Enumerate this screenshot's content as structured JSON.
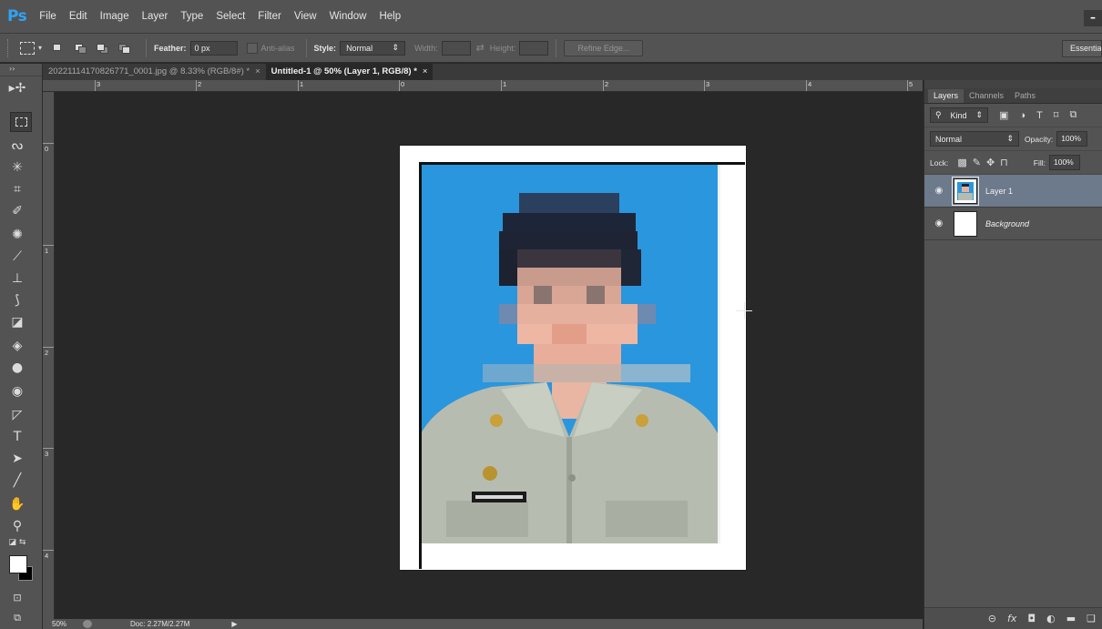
{
  "app": {
    "logo": "Ps"
  },
  "menu": [
    "File",
    "Edit",
    "Image",
    "Layer",
    "Type",
    "Select",
    "Filter",
    "View",
    "Window",
    "Help"
  ],
  "window": {
    "minimize": "–"
  },
  "options": {
    "feather_label": "Feather:",
    "feather_value": "0 px",
    "antialias_label": "Anti-alias",
    "style_label": "Style:",
    "style_value": "Normal",
    "width_label": "Width:",
    "height_label": "Height:",
    "refine_label": "Refine Edge...",
    "workspace": "Essentials"
  },
  "tabs": [
    {
      "label": "20221114170826771_0001.jpg @ 8.33% (RGB/8#) *",
      "close": "×"
    },
    {
      "label": "Untitled-1 @ 50% (Layer 1, RGB/8) *",
      "close": "×"
    }
  ],
  "ruler": {
    "top": [
      "3",
      "2",
      "1",
      "0",
      "1",
      "2",
      "3",
      "4",
      "5"
    ],
    "left": [
      "0",
      "1",
      "2",
      "3",
      "4"
    ]
  },
  "status": {
    "zoom": "50%",
    "doc": "Doc: 2.27M/2.27M",
    "arrow": "▶"
  },
  "layers_panel": {
    "tabs": [
      "Layers",
      "Channels",
      "Paths"
    ],
    "kind_label": "Kind",
    "blend_mode": "Normal",
    "opacity_label": "Opacity:",
    "opacity_value": "100%",
    "lock_label": "Lock:",
    "fill_label": "Fill:",
    "fill_value": "100%",
    "layers": [
      {
        "name": "Layer 1",
        "selected": true
      },
      {
        "name": "Background",
        "selected": false
      }
    ]
  },
  "colors": {
    "accent": "#2fa3f6",
    "photo_background": "#2a96dd",
    "uniform": "#b7bcb1",
    "selected_layer": "#6c7a8b"
  }
}
